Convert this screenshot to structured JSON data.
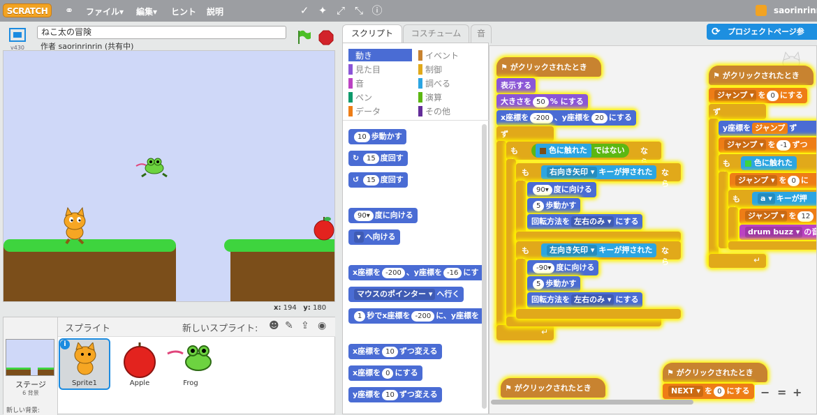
{
  "menubar": {
    "logo": "SCRATCH",
    "file": "ファイル▾",
    "edit": "編集▾",
    "tips": "ヒント",
    "about": "説明",
    "user": "saorinrinrin"
  },
  "project": {
    "title": "ねこ太の冒険",
    "author": "作者 saorinrinrin (共有中)",
    "version": "v430"
  },
  "coords": {
    "x_label": "x:",
    "x": "194",
    "y_label": "y:",
    "y": "180"
  },
  "sprites": {
    "header": "スプライト",
    "new_sprite": "新しいスプライト:",
    "stage_label": "ステージ",
    "stage_count": "6 背景",
    "new_backdrop": "新しい背景:",
    "items": [
      {
        "name": "Sprite1"
      },
      {
        "name": "Apple"
      },
      {
        "name": "Frog"
      }
    ]
  },
  "tabs": {
    "scripts": "スクリプト",
    "costumes": "コスチューム",
    "sounds": "音"
  },
  "project_page_btn": "プロジェクトページ参",
  "categories": [
    {
      "label": "動き",
      "color": "#4a6cd4",
      "active": true
    },
    {
      "label": "イベント",
      "color": "#c88330"
    },
    {
      "label": "見た目",
      "color": "#8a55d7"
    },
    {
      "label": "制御",
      "color": "#e1a91a"
    },
    {
      "label": "音",
      "color": "#bb42c3"
    },
    {
      "label": "調べる",
      "color": "#2ca5e2"
    },
    {
      "label": "ペン",
      "color": "#0e9a6c"
    },
    {
      "label": "演算",
      "color": "#5cb712"
    },
    {
      "label": "データ",
      "color": "#ee7d16"
    },
    {
      "label": "その他",
      "color": "#632d99"
    }
  ],
  "palette": {
    "move": "歩動かす",
    "move_n": "10",
    "turn_r": "度回す",
    "turn_r_n": "15",
    "turn_l": "度回す",
    "turn_l_n": "15",
    "point_dir": "度に向ける",
    "point_dir_n": "90▾",
    "point_towards": "へ向ける",
    "goto_xy_a": "x座標を",
    "goto_xy_x": "-200",
    "goto_xy_b": "、y座標を",
    "goto_xy_y": "-16",
    "goto_xy_c": "にす",
    "goto": "マウスのポインター ▾",
    "goto_b": "へ行く",
    "glide_a": "秒でx座標を",
    "glide_n": "1",
    "glide_x": "-200",
    "glide_b": "に、y座標を",
    "chx_a": "x座標を",
    "chx_n": "10",
    "chx_b": "ずつ変える",
    "setx_a": "x座標を",
    "setx_n": "0",
    "setx_b": "にする",
    "chy_a": "y座標を",
    "chy_n": "10",
    "chy_b": "ずつ変える"
  },
  "script1": {
    "hat": "がクリックされたとき",
    "show": "表示する",
    "size_a": "大きさを",
    "size_n": "50",
    "size_b": "% にする",
    "goto_a": "x座標を",
    "goto_x": "-200",
    "goto_b": "、y座標を",
    "goto_y": "20",
    "goto_c": "にする",
    "forever": "ずっと",
    "if": "もし",
    "touch_color": "色に触れた",
    "not": "ではない",
    "then": "なら",
    "key_right": "右向き矢印 ▾",
    "key_pressed": "キーが押された",
    "dir90": "90▾",
    "dir_b": "度に向ける",
    "move5": "5",
    "move_b": "歩動かす",
    "rot": "回転方法を",
    "rot_val": "左右のみ ▾",
    "rot_b": "にする",
    "key_left": "左向き矢印 ▾",
    "dirm90": "-90▾"
  },
  "script2": {
    "hat": "がクリックされたとき",
    "set_var": "ジャンプ ▾",
    "set_a": "を",
    "set_n": "0",
    "set_b": "にする",
    "forever": "ずっと",
    "y_a": "y座標を",
    "y_var": "ジャンプ",
    "y_b": "ず",
    "ch_var": "ジャンプ ▾",
    "ch_a": "を",
    "ch_n": "-1",
    "ch_b": "ずつ",
    "if": "もし",
    "touch": "色に触れた",
    "set2_var": "ジャンプ ▾",
    "set2_n": "0",
    "set2_b": "に",
    "key": "a ▾",
    "key_b": "キーが押",
    "set3_var": "ジャンプ ▾",
    "set3_n": "12",
    "drum": "drum buzz ▾",
    "drum_b": "の音"
  },
  "script3": {
    "hat": "がクリックされたとき"
  },
  "script4": {
    "hat": "がクリックされたとき",
    "var": "NEXT ▾",
    "a": "を",
    "n": "0",
    "b": "にする"
  },
  "zoom": {
    "out": "−",
    "reset": "=",
    "in": "+"
  }
}
